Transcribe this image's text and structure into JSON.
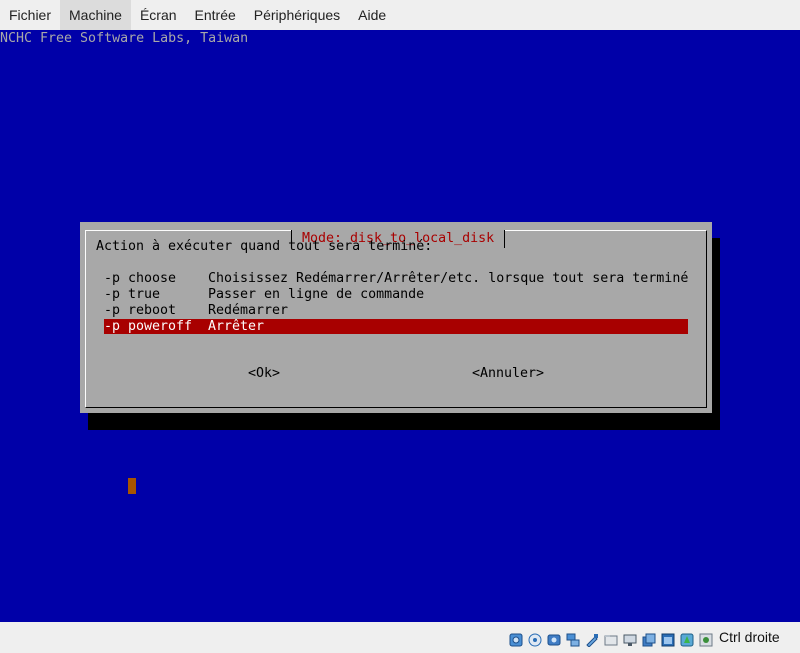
{
  "menubar": {
    "items": [
      "Fichier",
      "Machine",
      "Écran",
      "Entrée",
      "Périphériques",
      "Aide"
    ]
  },
  "console": {
    "banner": "NCHC Free Software Labs, Taiwan",
    "dialog": {
      "title": "Mode: disk_to_local_disk",
      "prompt": "Action à exécuter quand tout sera terminé:",
      "options": [
        {
          "tag": "-p choose",
          "desc": "Choisissez Redémarrer/Arrêter/etc. lorsque tout sera terminé"
        },
        {
          "tag": "-p true",
          "desc": "Passer en ligne de commande"
        },
        {
          "tag": "-p reboot",
          "desc": "Redémarrer"
        },
        {
          "tag": "-p poweroff",
          "desc": "Arrêter"
        }
      ],
      "selected_option": "-p poweroff",
      "ok_label": "<Ok>",
      "cancel_label": "<Annuler>"
    }
  },
  "statusbar": {
    "host_key_label": "Ctrl droite",
    "indicator_icons": [
      "hard-disk-icon",
      "optical-drive-icon",
      "audio-icon",
      "network-icon",
      "usb-icon",
      "shared-folder-icon",
      "display-icon",
      "screen-capture-icon",
      "vm-window-icon",
      "mouse-integration-icon",
      "recording-icon",
      "keyboard-capture-icon"
    ]
  },
  "colors": {
    "console_bg": "#0000a8",
    "dialog_bg": "#a8a8a8",
    "highlight": "#a80000",
    "cursor": "#a85400"
  }
}
